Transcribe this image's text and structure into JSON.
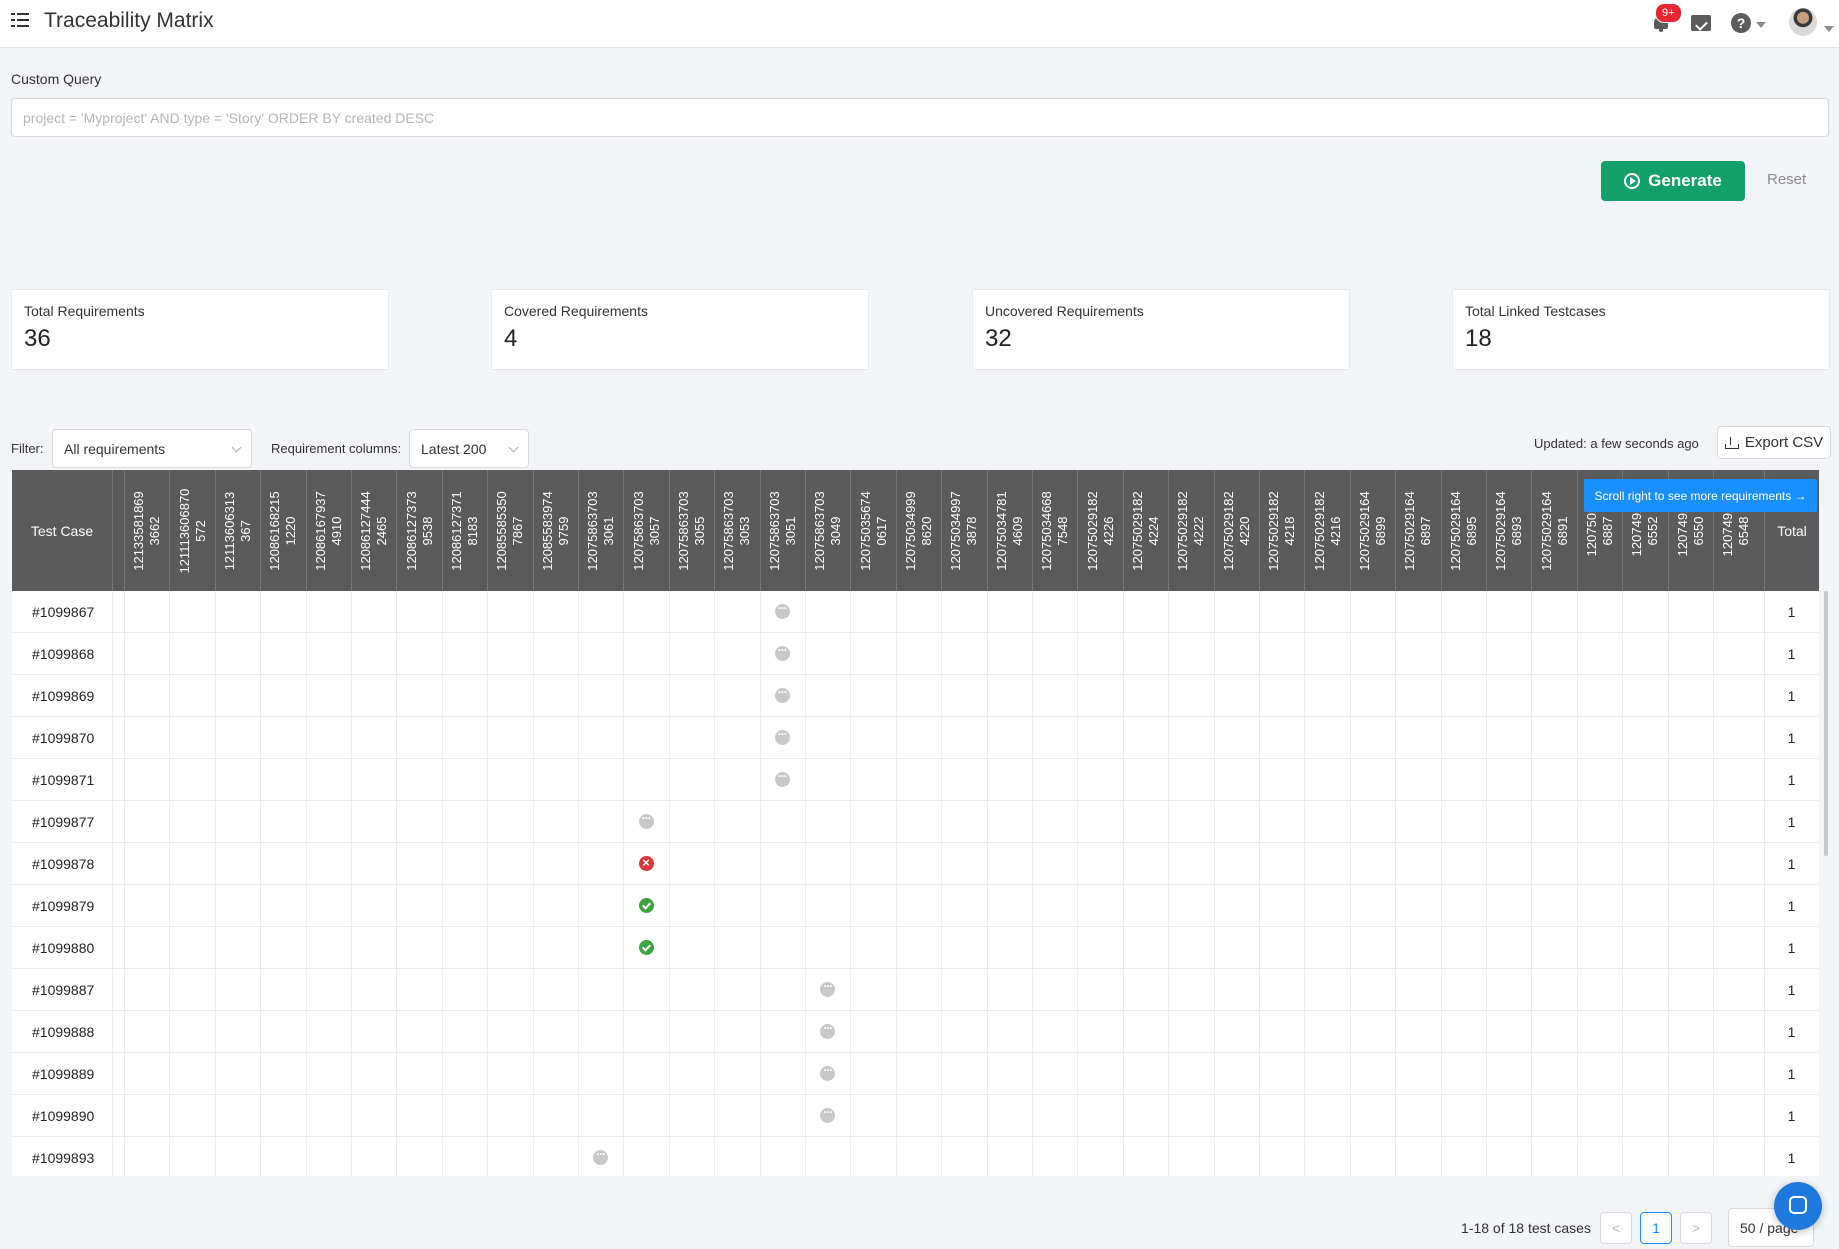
{
  "header": {
    "title": "Traceability Matrix",
    "notifications_badge": "9+",
    "help_label": "?"
  },
  "query": {
    "label": "Custom Query",
    "placeholder": "project = 'Myproject' AND type = 'Story' ORDER BY created DESC",
    "value": "",
    "generate_label": "Generate",
    "reset_label": "Reset"
  },
  "stats": [
    {
      "label": "Total Requirements",
      "value": "36"
    },
    {
      "label": "Covered Requirements",
      "value": "4"
    },
    {
      "label": "Uncovered Requirements",
      "value": "32"
    },
    {
      "label": "Total Linked Testcases",
      "value": "18"
    }
  ],
  "toolbar": {
    "filter_label": "Filter:",
    "filter_value": "All requirements",
    "columns_label": "Requirement columns:",
    "columns_value": "Latest 200",
    "updated_text": "Updated: a few seconds ago",
    "export_label": "Export CSV"
  },
  "matrix": {
    "test_case_header": "Test Case",
    "total_header": "Total",
    "scroll_hint": "Scroll right to see more requirements →",
    "requirement_columns": [
      "12133581869\n3662",
      "121113606870\n572",
      "12113606313\n367",
      "12086168215\n1220",
      "12086167937\n4910",
      "12086127444\n2465",
      "12086127373\n9538",
      "12086127371\n8183",
      "12085585350\n7867",
      "12085583974\n9759",
      "12075863703\n3061",
      "12075863703\n3057",
      "12075863703\n3055",
      "12075863703\n3053",
      "12075863703\n3051",
      "12075863703\n3049",
      "12075035674\n0617",
      "12075034999\n8620",
      "12075034997\n3878",
      "12075034781\n4609",
      "12075034668\n7548",
      "12075029182\n4226",
      "12075029182\n4224",
      "12075029182\n4222",
      "12075029182\n4220",
      "12075029182\n4218",
      "12075029182\n4216",
      "12075029164\n6899",
      "12075029164\n6897",
      "12075029164\n6895",
      "12075029164\n6893",
      "12075029164\n6891",
      "1207502\n6887",
      "1207492\n6552",
      "1207492\n6550",
      "1207492\n6548"
    ],
    "rows": [
      {
        "id": "#1099867",
        "col": 14,
        "status": "pending",
        "total": "1"
      },
      {
        "id": "#1099868",
        "col": 14,
        "status": "pending",
        "total": "1"
      },
      {
        "id": "#1099869",
        "col": 14,
        "status": "pending",
        "total": "1"
      },
      {
        "id": "#1099870",
        "col": 14,
        "status": "pending",
        "total": "1"
      },
      {
        "id": "#1099871",
        "col": 14,
        "status": "pending",
        "total": "1"
      },
      {
        "id": "#1099877",
        "col": 11,
        "status": "pending",
        "total": "1"
      },
      {
        "id": "#1099878",
        "col": 11,
        "status": "fail",
        "total": "1"
      },
      {
        "id": "#1099879",
        "col": 11,
        "status": "pass",
        "total": "1"
      },
      {
        "id": "#1099880",
        "col": 11,
        "status": "pass",
        "total": "1"
      },
      {
        "id": "#1099887",
        "col": 15,
        "status": "pending",
        "total": "1"
      },
      {
        "id": "#1099888",
        "col": 15,
        "status": "pending",
        "total": "1"
      },
      {
        "id": "#1099889",
        "col": 15,
        "status": "pending",
        "total": "1"
      },
      {
        "id": "#1099890",
        "col": 15,
        "status": "pending",
        "total": "1"
      },
      {
        "id": "#1099893",
        "col": 10,
        "status": "pending",
        "total": "1"
      }
    ]
  },
  "pagination": {
    "summary": "1-18 of 18 test cases",
    "prev_label": "<",
    "current_page": "1",
    "next_label": ">",
    "page_size": "50 / page"
  },
  "colors": {
    "accent": "#13a06b",
    "header_bg": "#5b5b5b",
    "hint_bg": "#1890ff",
    "fail": "#d9363e",
    "pass": "#3fa33f",
    "pending": "#c8c8c8"
  },
  "icons": [
    "menu-icon",
    "bell-icon",
    "calendar-check-icon",
    "help-icon",
    "play-circle-icon",
    "download-icon",
    "chat-icon"
  ]
}
